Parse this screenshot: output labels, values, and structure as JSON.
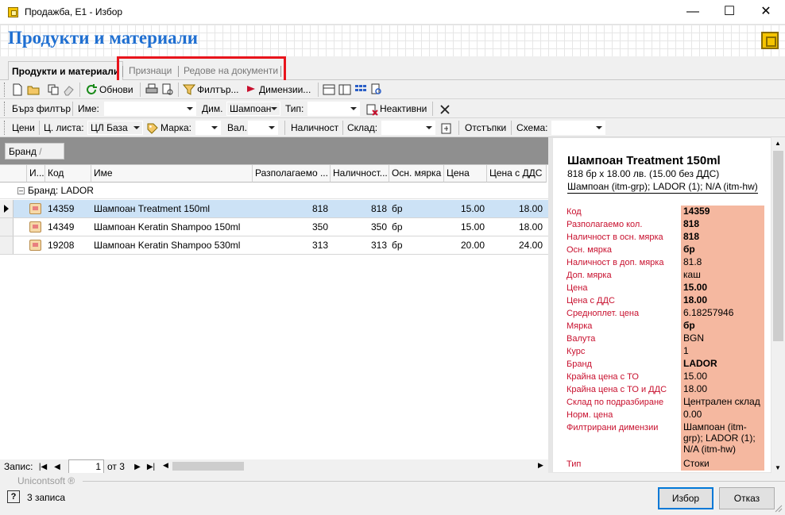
{
  "window": {
    "title": "Продажба, Е1 - Избор",
    "minimize": "—",
    "maximize": "☐",
    "close": "✕"
  },
  "page_title": "Продукти и материали",
  "tabs": [
    {
      "label": "Продукти и материали"
    },
    {
      "label": "Признаци"
    },
    {
      "label": "Редове на документи"
    }
  ],
  "toolbar1": {
    "refresh": "Обнови",
    "filter": "Филтър...",
    "dimensions": "Димензии..."
  },
  "toolbar2": {
    "quick_filter": "Бърз филтър",
    "name_label": "Име:",
    "name_value": "",
    "dim_label": "Дим.",
    "dim_value": "Шампоан",
    "type_label": "Тип:",
    "type_value": "",
    "inactive": "Неактивни"
  },
  "toolbar3": {
    "prices": "Цени",
    "price_list_label": "Ц. листа:",
    "price_list_value": "ЦЛ База",
    "brand_label": "Марка:",
    "brand_value": "",
    "currency_label": "Вал.",
    "currency_value": "",
    "availability": "Наличност",
    "warehouse_label": "Склад:",
    "warehouse_value": "",
    "discounts": "Отстъпки",
    "scheme_label": "Схема:",
    "scheme_value": ""
  },
  "group_panel": {
    "chip": "Бранд"
  },
  "grid": {
    "columns": [
      "И...",
      "Код",
      "Име",
      "Разполагаемо ...",
      "Наличност...",
      "Осн. мярка",
      "Цена",
      "Цена с ДДС"
    ],
    "group_label": "Бранд: LADOR",
    "rows": [
      {
        "code": "14359",
        "name": "Шампоан Treatment 150ml",
        "available": "818",
        "stock": "818",
        "unit": "бр",
        "price": "15.00",
        "price_vat": "18.00"
      },
      {
        "code": "14349",
        "name": "Шампоан Keratin Shampoo 150ml",
        "available": "350",
        "stock": "350",
        "unit": "бр",
        "price": "15.00",
        "price_vat": "18.00"
      },
      {
        "code": "19208",
        "name": "Шампоан Keratin Shampoo 530ml",
        "available": "313",
        "stock": "313",
        "unit": "бр",
        "price": "20.00",
        "price_vat": "24.00"
      }
    ]
  },
  "pager": {
    "label": "Запис:",
    "current": "1",
    "total_text": "от 3"
  },
  "detail": {
    "title": "Шампоан Treatment 150ml",
    "subtitle": "818 бр x 18.00 лв. (15.00 без ДДС)",
    "subtitle2": "Шампоан (itm-grp); LADOR (1); N/A (itm-hw)",
    "fields": [
      {
        "label": "Код",
        "value": "14359"
      },
      {
        "label": "Разполагаемо кол.",
        "value": "818"
      },
      {
        "label": "Наличност в осн. мярка",
        "value": "818"
      },
      {
        "label": "Осн. мярка",
        "value": "бр"
      },
      {
        "label": "Наличност в доп. мярка",
        "value": "81.8"
      },
      {
        "label": "Доп. мярка",
        "value": "каш"
      },
      {
        "label": "Цена",
        "value": "15.00"
      },
      {
        "label": "Цена с ДДС",
        "value": "18.00"
      },
      {
        "label": "Средноплет. цена",
        "value": "6.18257946"
      },
      {
        "label": "Мярка",
        "value": "бр"
      },
      {
        "label": "Валута",
        "value": "BGN"
      },
      {
        "label": "Курс",
        "value": "1"
      },
      {
        "label": "Бранд",
        "value": "LADOR"
      },
      {
        "label": "Крайна цена с ТО",
        "value": "15.00"
      },
      {
        "label": "Крайна цена с ТО и ДДС",
        "value": "18.00"
      },
      {
        "label": "Склад по подразбиране",
        "value": "Централен склад"
      },
      {
        "label": "Норм. цена",
        "value": "0.00"
      },
      {
        "label": "Филтрирани димензии",
        "value": "Шампоан (itm-grp); LADOR (1); N/A (itm-hw)"
      },
      {
        "label": "Тип",
        "value": "Стоки"
      }
    ]
  },
  "footer": {
    "brand": "Unicontsoft ®",
    "status": "3 записа",
    "select_button": "Избор",
    "cancel_button": "Отказ"
  }
}
